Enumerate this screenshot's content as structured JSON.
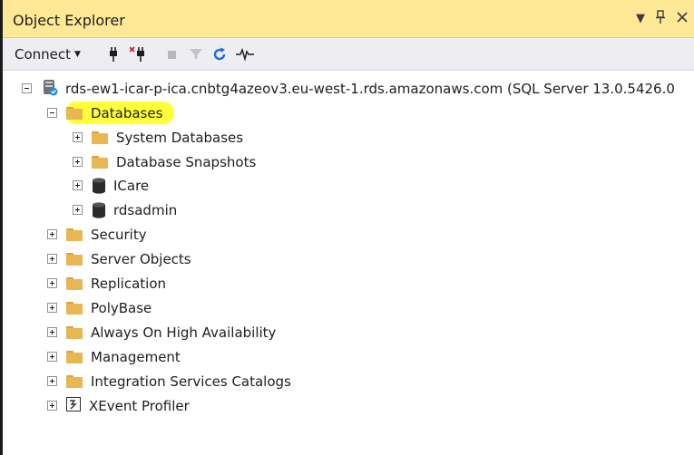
{
  "window": {
    "title": "Object Explorer",
    "pin_icon": "pin-icon",
    "close_icon": "close-icon"
  },
  "toolbar": {
    "connect_label": "Connect"
  },
  "tree": {
    "server": "rds-ew1-icar-p-ica.cnbtg4azeov3.eu-west-1.rds.amazonaws.com (SQL Server 13.0.5426.0",
    "databases": "Databases",
    "system_databases": "System Databases",
    "database_snapshots": "Database Snapshots",
    "icare": "ICare",
    "rdsadmin": "rdsadmin",
    "security": "Security",
    "server_objects": "Server Objects",
    "replication": "Replication",
    "polybase": "PolyBase",
    "always_on": "Always On High Availability",
    "management": "Management",
    "integration_services": "Integration Services Catalogs",
    "xevent_profiler": "XEvent Profiler"
  },
  "colors": {
    "title_bg": "#ffe896",
    "highlight": "#ffff2e",
    "folder": "#e8b652"
  }
}
